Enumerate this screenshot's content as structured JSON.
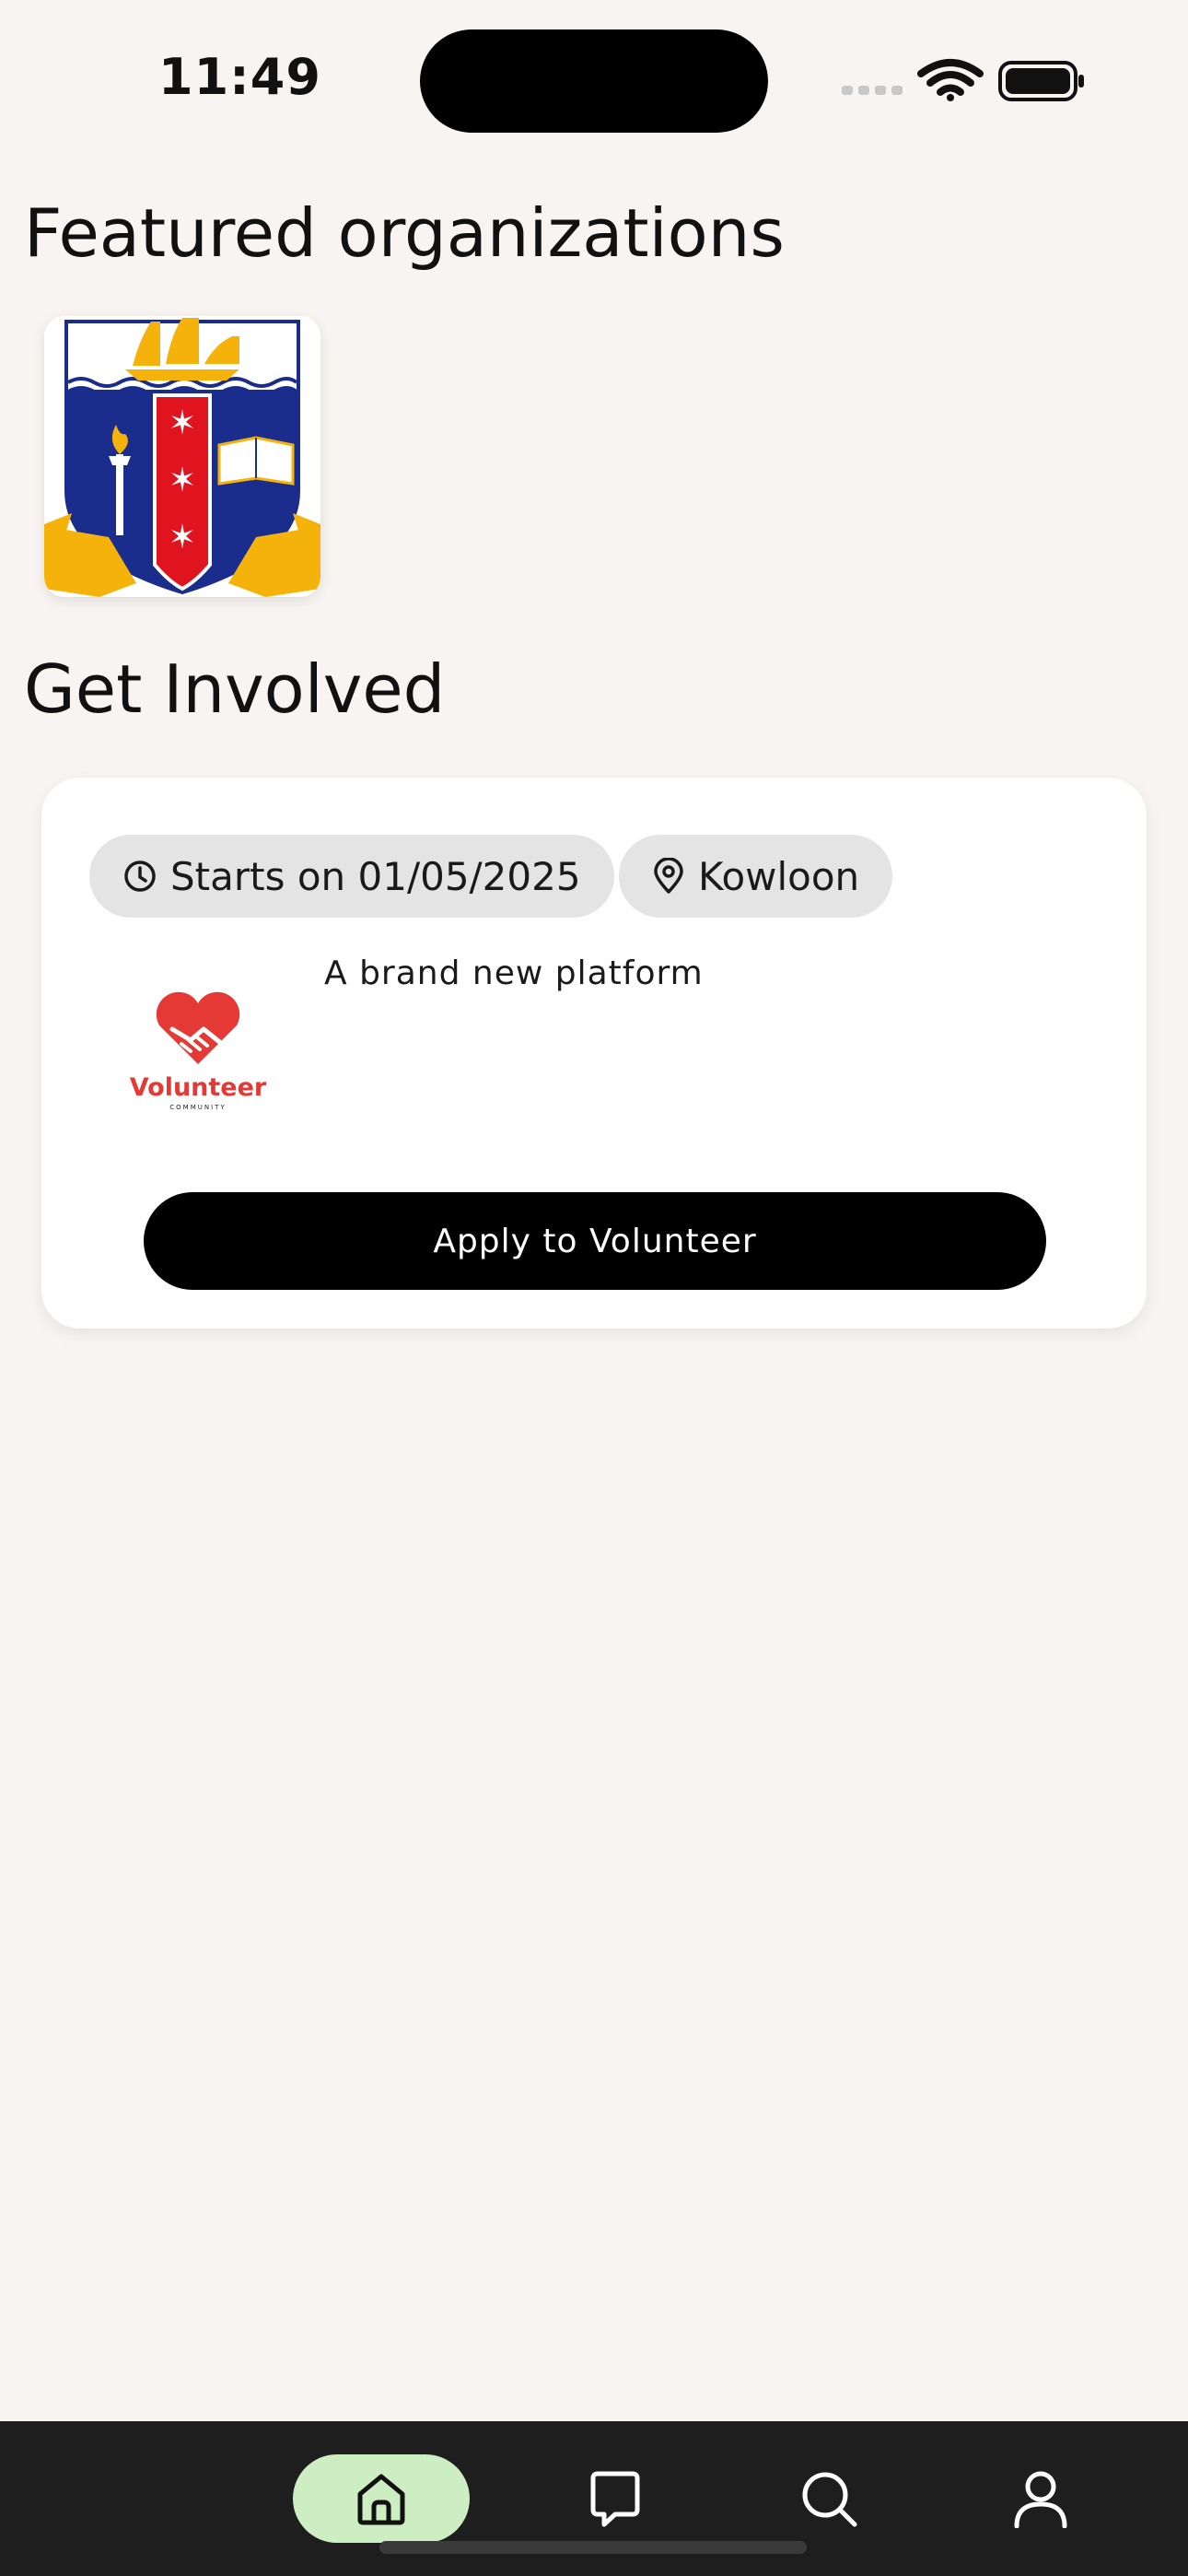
{
  "status_bar": {
    "time": "11:49",
    "icons": [
      "cellular-icon",
      "wifi-icon",
      "battery-icon"
    ]
  },
  "featured": {
    "title": "Featured organizations",
    "orgs": [
      {
        "logo": "school-crest-logo"
      }
    ]
  },
  "involved": {
    "title": "Get Involved",
    "opportunities": [
      {
        "start_label": "Starts on 01/05/2025",
        "location": "Kowloon",
        "org_logo": "volunteer-community-logo",
        "logo_text": "Volunteer",
        "logo_subtext": "COMMUNITY",
        "description": "A brand new platform",
        "apply_label": "Apply to Volunteer"
      }
    ]
  },
  "bottom_nav": {
    "items": [
      {
        "icon": "home-icon",
        "active": true
      },
      {
        "icon": "chat-icon",
        "active": false
      },
      {
        "icon": "search-icon",
        "active": false
      },
      {
        "icon": "profile-icon",
        "active": false
      }
    ]
  },
  "colors": {
    "background": "#f8f4f1",
    "active_nav": "#cdeec2",
    "nav_bar": "#1e1e1e",
    "apply_button": "#000000",
    "chip": "#e4e4e4",
    "volunteer_red": "#e53935",
    "crest_blue": "#1a2d8c",
    "crest_red": "#e0141e",
    "crest_gold": "#f5b20a"
  }
}
